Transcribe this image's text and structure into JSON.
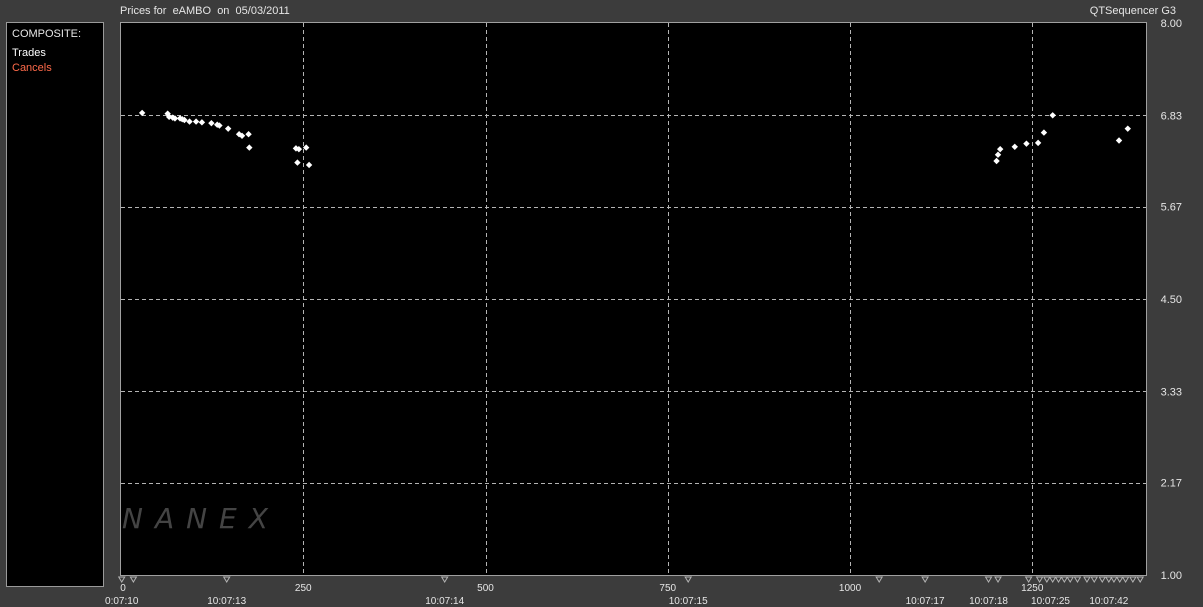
{
  "header": {
    "title": "Prices for  eAMBO  on  05/03/2011",
    "brand": "QTSequencer G3"
  },
  "legend": {
    "header": "COMPOSITE:",
    "items": [
      {
        "label": "Trades",
        "color": "#ffffff"
      },
      {
        "label": "Cancels",
        "color": "#ff6a4a"
      }
    ]
  },
  "watermark": "NANEX",
  "chart_data": {
    "type": "scatter",
    "title": "Prices for  eAMBO  on  05/03/2011",
    "xlabel": "",
    "ylabel": "",
    "xlim": [
      0,
      1406
    ],
    "ylim": [
      1.0,
      8.0
    ],
    "grid": true,
    "x_ticks": [
      0,
      250,
      500,
      750,
      1000,
      1250
    ],
    "y_ticks": [
      "1.00",
      "2.17",
      "3.33",
      "4.50",
      "5.67",
      "6.83",
      "8.00"
    ],
    "time_labels": [
      {
        "x": 1,
        "label": "0:07:10"
      },
      {
        "x": 145,
        "label": "10:07:13"
      },
      {
        "x": 444,
        "label": "10:07:14"
      },
      {
        "x": 778,
        "label": "10:07:15"
      },
      {
        "x": 1103,
        "label": "10:07:17"
      },
      {
        "x": 1190,
        "label": "10:07:18"
      },
      {
        "x": 1275,
        "label": "10:07:25"
      },
      {
        "x": 1355,
        "label": "10:07:42"
      }
    ],
    "series": [
      {
        "name": "Trades",
        "color": "#ffffff",
        "points": [
          [
            29,
            6.86
          ],
          [
            64,
            6.85
          ],
          [
            66,
            6.81
          ],
          [
            71,
            6.8
          ],
          [
            74,
            6.79
          ],
          [
            81,
            6.79
          ],
          [
            84,
            6.78
          ],
          [
            87,
            6.77
          ],
          [
            94,
            6.75
          ],
          [
            103,
            6.75
          ],
          [
            111,
            6.74
          ],
          [
            124,
            6.73
          ],
          [
            132,
            6.71
          ],
          [
            135,
            6.7
          ],
          [
            147,
            6.66
          ],
          [
            162,
            6.59
          ],
          [
            166,
            6.57
          ],
          [
            175,
            6.59
          ],
          [
            176,
            6.42
          ],
          [
            240,
            6.41
          ],
          [
            242,
            6.23
          ],
          [
            244,
            6.4
          ],
          [
            254,
            6.42
          ],
          [
            258,
            6.2
          ],
          [
            1201,
            6.25
          ],
          [
            1203,
            6.33
          ],
          [
            1206,
            6.4
          ],
          [
            1226,
            6.43
          ],
          [
            1242,
            6.47
          ],
          [
            1258,
            6.48
          ],
          [
            1266,
            6.61
          ],
          [
            1278,
            6.83
          ],
          [
            1369,
            6.51
          ],
          [
            1381,
            6.66
          ]
        ]
      }
    ],
    "cancel_markers_x": [
      1,
      17,
      145,
      444,
      778,
      1040,
      1103,
      1190,
      1203,
      1245,
      1260,
      1270,
      1278,
      1286,
      1294,
      1302,
      1312,
      1325,
      1335,
      1346,
      1355,
      1362,
      1370,
      1378,
      1388,
      1398
    ]
  }
}
